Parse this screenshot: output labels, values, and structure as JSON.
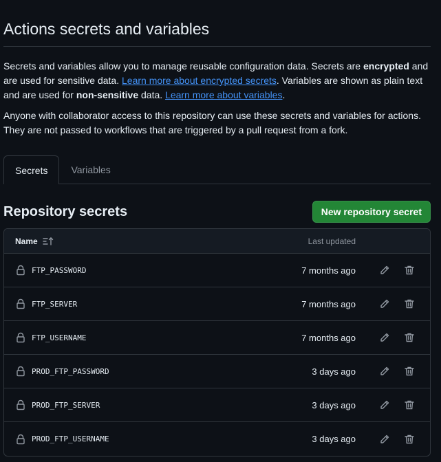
{
  "page": {
    "title": "Actions secrets and variables",
    "intro": {
      "p1_a": "Secrets and variables allow you to manage reusable configuration data. Secrets are ",
      "p1_bold1": "encrypted",
      "p1_b": " and are used for sensitive data. ",
      "p1_link1": "Learn more about encrypted secrets",
      "p1_c": ". Variables are shown as plain text and are used for ",
      "p1_bold2": "non-sensitive",
      "p1_d": " data. ",
      "p1_link2": "Learn more about variables",
      "p1_e": ".",
      "p2": "Anyone with collaborator access to this repository can use these secrets and variables for actions. They are not passed to workflows that are triggered by a pull request from a fork."
    }
  },
  "tabs": [
    {
      "label": "Secrets",
      "active": true
    },
    {
      "label": "Variables",
      "active": false
    }
  ],
  "section": {
    "title": "Repository secrets",
    "new_button": "New repository secret"
  },
  "table": {
    "col_name": "Name",
    "col_updated": "Last updated",
    "rows": [
      {
        "name": "FTP_PASSWORD",
        "updated": "7 months ago"
      },
      {
        "name": "FTP_SERVER",
        "updated": "7 months ago"
      },
      {
        "name": "FTP_USERNAME",
        "updated": "7 months ago"
      },
      {
        "name": "PROD_FTP_PASSWORD",
        "updated": "3 days ago"
      },
      {
        "name": "PROD_FTP_SERVER",
        "updated": "3 days ago"
      },
      {
        "name": "PROD_FTP_USERNAME",
        "updated": "3 days ago"
      }
    ]
  },
  "icons": {
    "lock": "lock-icon",
    "edit": "pencil-icon",
    "delete": "trash-icon",
    "sort": "sort-ascending-icon"
  },
  "colors": {
    "background": "#0d1117",
    "border": "#30363d",
    "link": "#4493f8",
    "primary_button": "#238636",
    "muted_text": "#9198a1"
  }
}
